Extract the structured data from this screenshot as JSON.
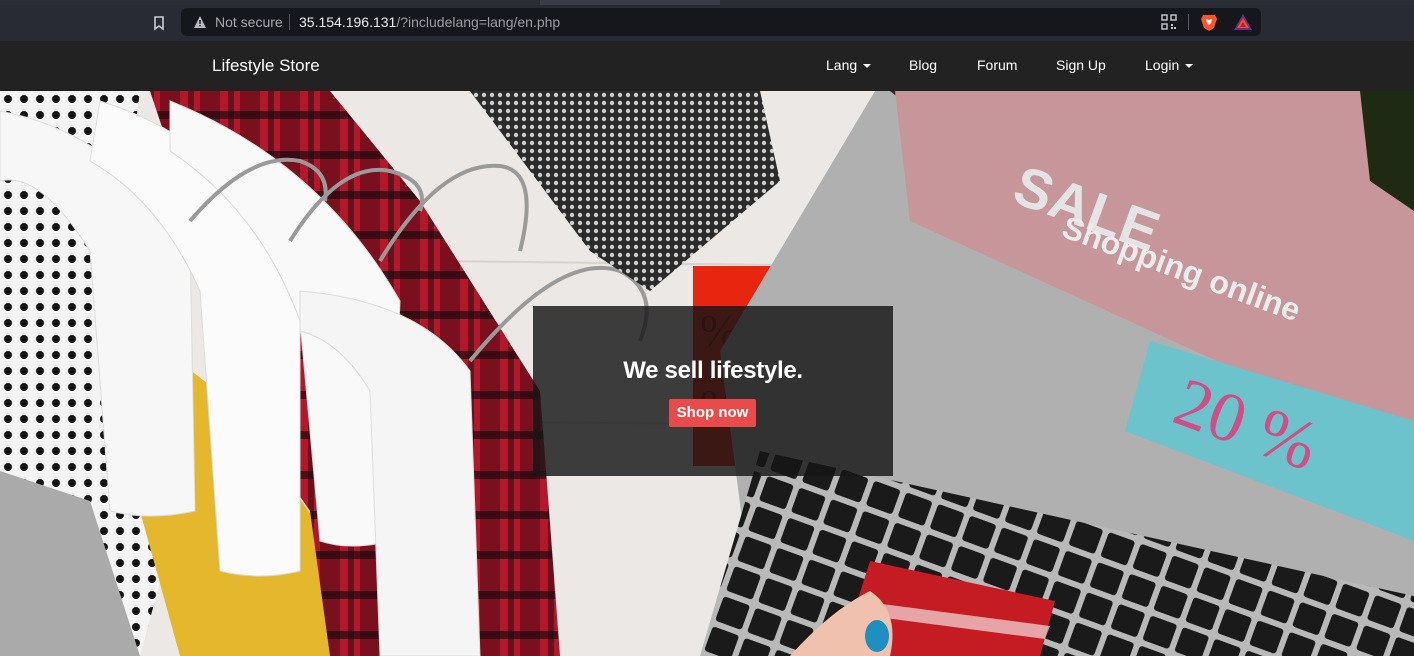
{
  "browser": {
    "security_label": "Not secure",
    "url_host": "35.154.196.131",
    "url_path": "/?includelang=lang/en.php",
    "icons": [
      "bookmark-icon",
      "warning-icon",
      "qr-code-icon",
      "brave-shields-icon",
      "brave-rewards-icon"
    ]
  },
  "navbar": {
    "brand": "Lifestyle Store",
    "items": [
      {
        "label": "Lang",
        "dropdown": true
      },
      {
        "label": "Blog",
        "dropdown": false
      },
      {
        "label": "Forum",
        "dropdown": false
      },
      {
        "label": "Sign Up",
        "dropdown": false
      },
      {
        "label": "Login",
        "dropdown": true
      }
    ]
  },
  "hero": {
    "tagline": "We sell lifestyle.",
    "cta": "Shop now",
    "image_text": {
      "sale": "SALE",
      "shopping": "Shopping online",
      "discount": "20 %",
      "tag_top": "%50",
      "tag_bottom": "%20"
    }
  },
  "colors": {
    "navbar_bg": "#222222",
    "cta_bg": "#e94b4b",
    "chrome_bg": "#292b34"
  }
}
